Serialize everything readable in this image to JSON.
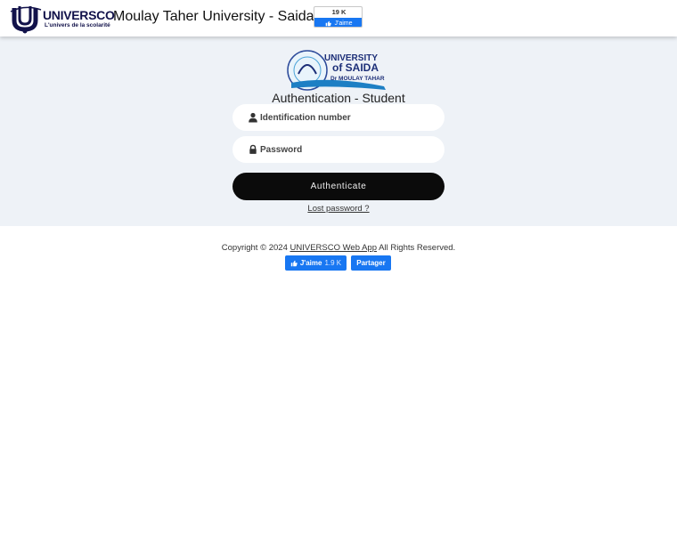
{
  "header": {
    "logo_word": "UNIVERSCO",
    "logo_tagline": "L'univers de la scolarité",
    "site_title": "Moulay Taher University - Saida",
    "fb_count": "19 K",
    "fb_like": "J'aime"
  },
  "login": {
    "uni_logo_line1": "UNIVERSITY",
    "uni_logo_line2": "of SAIDA",
    "uni_logo_line3": "Dr MOULAY TAHAR",
    "title": "Authentication - Student",
    "id_placeholder": "Identification number",
    "password_placeholder": "Password",
    "submit_label": "Authenticate",
    "lost_password": "Lost password ?"
  },
  "footer": {
    "copyright_prefix": "Copyright © 2024 ",
    "app_link": "UNIVERSCO Web App",
    "copyright_suffix": " All Rights Reserved.",
    "fb_like": "J'aime",
    "fb_like_count": "1.9 K",
    "fb_share": "Partager"
  },
  "colors": {
    "band_bg": "#eef2f7",
    "facebook_blue": "#1877f2",
    "button_dark": "#0b0b0b",
    "brand_navy": "#12124a"
  }
}
